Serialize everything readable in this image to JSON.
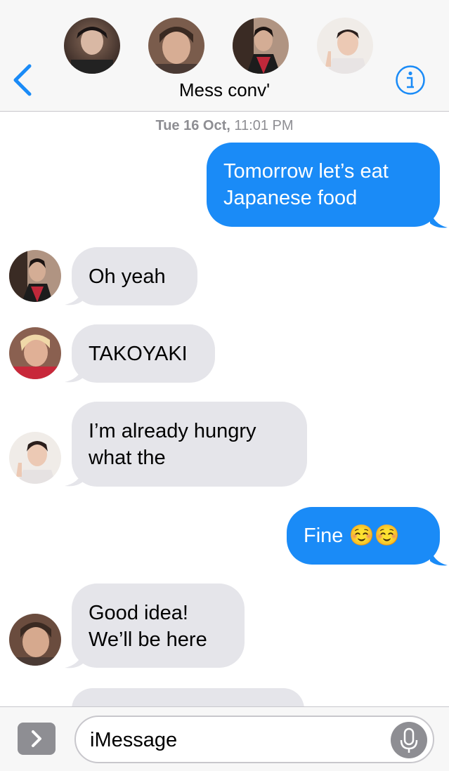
{
  "header": {
    "title": "Mess conv'",
    "participants": [
      {
        "name": "participant-1-avatar",
        "colors": [
          "#2a1e1c",
          "#8a6c5a"
        ]
      },
      {
        "name": "participant-2-avatar",
        "colors": [
          "#5a4236",
          "#c79e86"
        ]
      },
      {
        "name": "participant-3-avatar",
        "colors": [
          "#3a2b24",
          "#c0283a"
        ]
      },
      {
        "name": "participant-4-avatar",
        "colors": [
          "#f0ece8",
          "#3a2c2a"
        ]
      }
    ],
    "back_icon": "chevron-left-icon",
    "info_icon": "info-circle-icon"
  },
  "timestamp": {
    "day": "Tue 16 Oct,",
    "time": "11:01 PM"
  },
  "messages": [
    {
      "side": "out",
      "lines": [
        "Tomorrow let’s eat",
        "Japanese food"
      ]
    },
    {
      "side": "in",
      "lines": [
        "Oh yeah"
      ]
    },
    {
      "side": "in",
      "lines": [
        "TAKOYAKI"
      ]
    },
    {
      "side": "in",
      "lines": [
        "I’m already hungry",
        "what the"
      ]
    },
    {
      "side": "out",
      "lines": [
        "Fine ☺️☺️"
      ]
    },
    {
      "side": "in",
      "lines": [
        "Good idea!",
        "We’ll be here"
      ]
    }
  ],
  "composer": {
    "placeholder": "iMessage"
  },
  "colors": {
    "accent": "#1a8bf7",
    "incoming": "#e5e5ea",
    "bar": "#f7f7f7"
  }
}
